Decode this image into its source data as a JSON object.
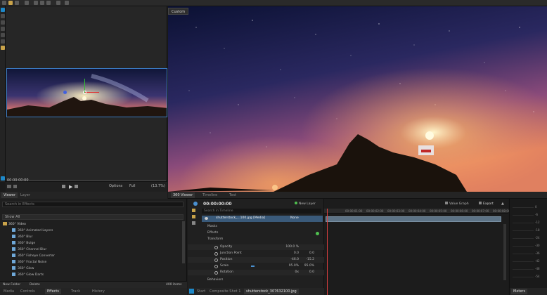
{
  "viewer": {
    "custom_tab": "Custom",
    "timecode": "00:00:00:00",
    "options_label": "Options",
    "zoom_label": "Full",
    "zoom_percent": "(13.7%)",
    "tabs": [
      "Viewer",
      "Layer"
    ]
  },
  "center_tabs": [
    "360 Viewer",
    "Timeline",
    "Text"
  ],
  "effects_panel": {
    "tabs": [
      "Media",
      "Controls",
      "Effects",
      "Track",
      "History"
    ],
    "search_placeholder": "Search in Effects",
    "filter_value": "Show All",
    "folder": "360° Video",
    "items": [
      "360° Animated Layers",
      "360° Blur",
      "360° Bulge",
      "360° Channel Blur",
      "360° Fisheye Converter",
      "360° Fractal Noise",
      "360° Glow",
      "360° Glow Darts"
    ],
    "new_folder": "New Folder",
    "delete": "Delete",
    "count": "400 items"
  },
  "timeline": {
    "timecode": "00:00:00:00",
    "new_layer": "New Layer",
    "search_placeholder": "Search in Timeline",
    "layer_name": "shutterstock_...100.jpg [Media]",
    "blend_mode": "None",
    "value_graph": "Value Graph",
    "export": "Export",
    "ruler_marks": [
      "00:00:01:00",
      "00:00:02:00",
      "00:00:03:00",
      "00:00:04:00",
      "00:00:05:00",
      "00:00:06:00",
      "00:00:07:00",
      "00:00:08:00"
    ],
    "rows": {
      "masks": "Masks",
      "effects": "Effects",
      "transform": "Transform",
      "opacity": {
        "name": "Opacity",
        "v1": "100.0 %",
        "v2": ""
      },
      "junction": {
        "name": "Junction Point",
        "v1": "0.0",
        "v2": "0.0"
      },
      "position": {
        "name": "Position",
        "v1": "-46.0",
        "v2": "-15.2"
      },
      "scale": {
        "name": "Scale",
        "v1": "95.0%",
        "v2": "95.0%"
      },
      "rotation": {
        "name": "Rotation",
        "v1": "0x",
        "v2": "0.0"
      },
      "behaviors": "Behaviors"
    }
  },
  "bottom_tabs": [
    "Start",
    "Composite Shot 1",
    "shutterstock_307632100.jpg"
  ],
  "meters": {
    "label": "Meters",
    "scale": [
      "0",
      "-6",
      "-12",
      "-18",
      "-24",
      "-30",
      "-36",
      "-42",
      "-48",
      "-54"
    ]
  },
  "colors": {
    "accent": "#1e88c8",
    "playhead": "#e04040",
    "clip": "#5d7386"
  }
}
